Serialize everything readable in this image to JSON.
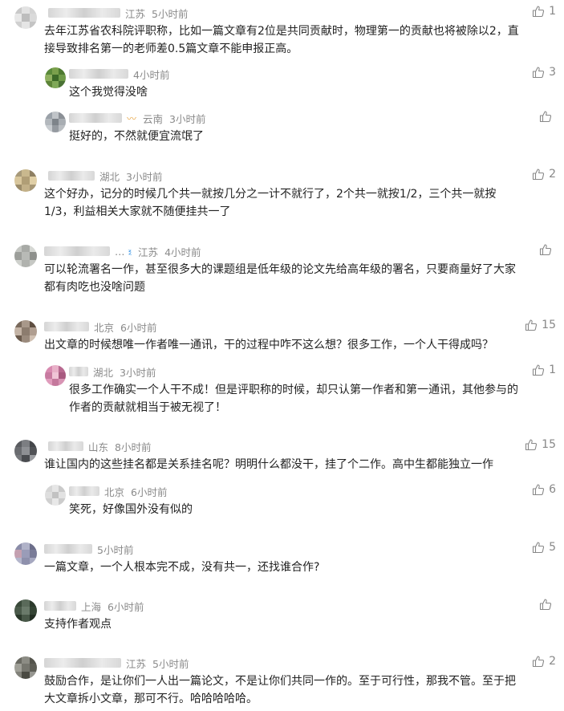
{
  "icons": {
    "like": "thumbs-up-icon",
    "verified": "verified-badge-icon"
  },
  "colors": {
    "text": "#222222",
    "meta": "#8a8a8a",
    "badge": "#4a9ee8"
  },
  "comments": [
    {
      "location": "江苏",
      "time": "5小时前",
      "likes": "1",
      "lines": [
        "去年江苏省农科院评职称，比如一篇文章有2位是共同贡献时，物理第一的贡献也将被除以2，直",
        "接导致排名第一的老师差0.5篇文章不能申报正高。"
      ]
    },
    {
      "location": "",
      "time": "4小时前",
      "likes": "3",
      "lines": [
        "这个我觉得没啥"
      ]
    },
    {
      "location": "云南",
      "time": "3小时前",
      "likes": "",
      "lines": [
        "挺好的，不然就便宜流氓了"
      ]
    },
    {
      "location": "湖北",
      "time": "3小时前",
      "likes": "2",
      "lines": [
        "这个好办，记分的时候几个共一就按几分之一计不就行了，2个共一就按1/2，三个共一就按",
        "1/3，利益相关大家就不随便挂共一了"
      ]
    },
    {
      "location": "江苏",
      "time": "4小时前",
      "likes": "",
      "lines": [
        "可以轮流署名一作，甚至很多大的课题组是低年级的论文先给高年级的署名，只要商量好了大家",
        "都有肉吃也没啥问题"
      ]
    },
    {
      "location": "北京",
      "time": "6小时前",
      "likes": "15",
      "lines": [
        "出文章的时候想唯一作者唯一通讯，干的过程中咋不这么想？很多工作，一个人干得成吗？"
      ]
    },
    {
      "location": "湖北",
      "time": "3小时前",
      "likes": "1",
      "lines": [
        "很多工作确实一个人干不成！但是评职称的时候，却只认第一作者和第一通讯，其他参与的",
        "作者的贡献就相当于被无视了！"
      ]
    },
    {
      "location": "山东",
      "time": "8小时前",
      "likes": "15",
      "lines": [
        "谁让国内的这些挂名都是关系挂名呢？明明什么都没干，挂了个二作。高中生都能独立一作"
      ]
    },
    {
      "location": "北京",
      "time": "6小时前",
      "likes": "6",
      "lines": [
        "笑死，好像国外没有似的"
      ]
    },
    {
      "location": "",
      "time": "5小时前",
      "likes": "5",
      "lines": [
        "一篇文章，一个人根本完不成，没有共一，还找谁合作?"
      ]
    },
    {
      "location": "上海",
      "time": "6小时前",
      "likes": "",
      "lines": [
        "支持作者观点"
      ]
    },
    {
      "location": "江苏",
      "time": "5小时前",
      "likes": "2",
      "lines": [
        "鼓励合作，是让你们一人出一篇论文，不是让你们共同一作的。至于可行性，那我不管。至于把",
        "大文章拆小文章，那可不行。哈哈哈哈哈。"
      ]
    }
  ]
}
